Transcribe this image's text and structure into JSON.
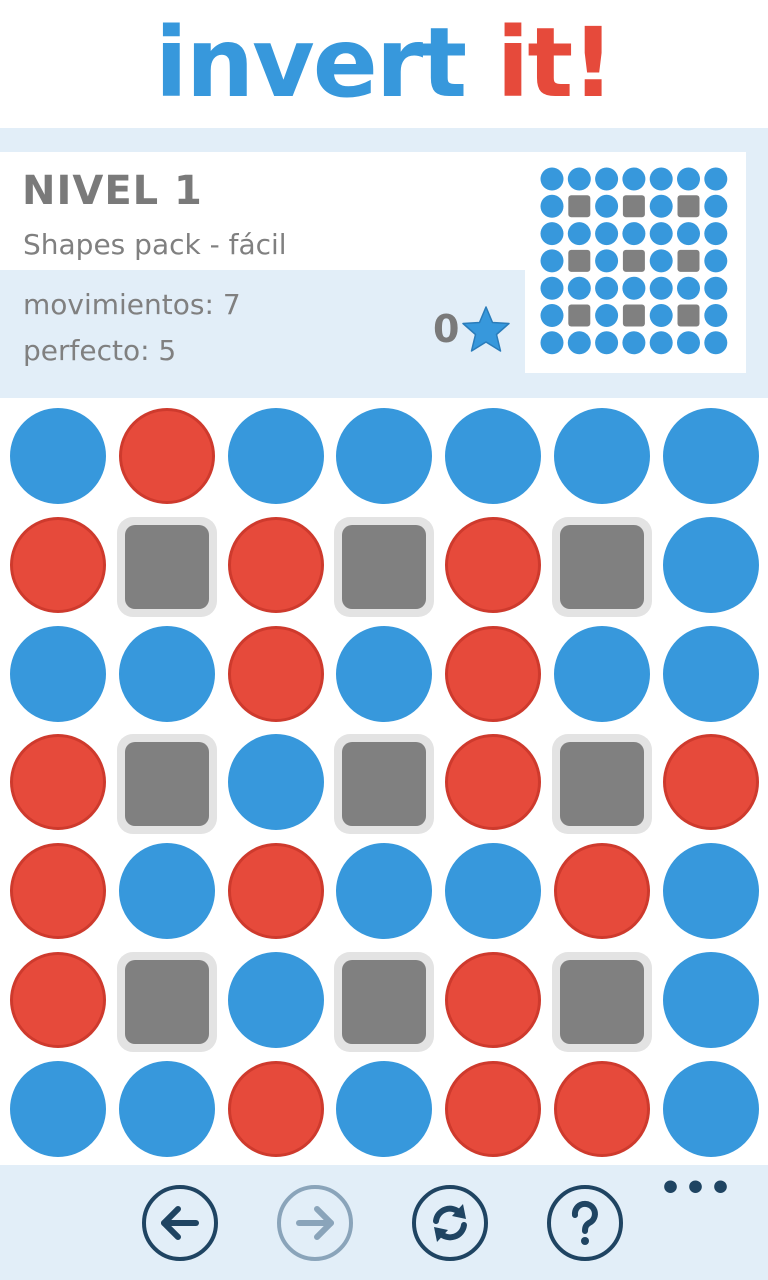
{
  "logo": {
    "part1": "invert",
    "part2": "it!"
  },
  "level": {
    "title": "NIVEL 1",
    "subtitle": "Shapes pack - fácil"
  },
  "stats": {
    "moves": "movimientos: 7",
    "perfect": "perfecto: 5",
    "stars": "0"
  },
  "colors": {
    "blue": "#3798DC",
    "red": "#E64A3B",
    "block": "#808080",
    "panel": "#E2EEF8",
    "dark": "#1F4462"
  },
  "board": [
    [
      "B",
      "R",
      "B",
      "B",
      "B",
      "B",
      "B"
    ],
    [
      "R",
      "X",
      "R",
      "X",
      "R",
      "X",
      "B"
    ],
    [
      "B",
      "B",
      "R",
      "B",
      "R",
      "B",
      "B"
    ],
    [
      "R",
      "X",
      "B",
      "X",
      "R",
      "X",
      "R"
    ],
    [
      "R",
      "B",
      "R",
      "B",
      "B",
      "R",
      "B"
    ],
    [
      "R",
      "X",
      "B",
      "X",
      "R",
      "X",
      "B"
    ],
    [
      "B",
      "B",
      "R",
      "B",
      "R",
      "R",
      "B"
    ]
  ],
  "preview": [
    [
      "B",
      "B",
      "B",
      "B",
      "B",
      "B",
      "B"
    ],
    [
      "B",
      "X",
      "B",
      "X",
      "B",
      "X",
      "B"
    ],
    [
      "B",
      "B",
      "B",
      "B",
      "B",
      "B",
      "B"
    ],
    [
      "B",
      "X",
      "B",
      "X",
      "B",
      "X",
      "B"
    ],
    [
      "B",
      "B",
      "B",
      "B",
      "B",
      "B",
      "B"
    ],
    [
      "B",
      "X",
      "B",
      "X",
      "B",
      "X",
      "B"
    ],
    [
      "B",
      "B",
      "B",
      "B",
      "B",
      "B",
      "B"
    ]
  ],
  "appbar": {
    "buttons": [
      {
        "name": "back-button",
        "icon": "arrow-left-icon",
        "enabled": true
      },
      {
        "name": "forward-button",
        "icon": "arrow-right-icon",
        "enabled": false
      },
      {
        "name": "restart-button",
        "icon": "refresh-icon",
        "enabled": true
      },
      {
        "name": "help-button",
        "icon": "question-icon",
        "enabled": true
      }
    ],
    "more": "•••"
  }
}
